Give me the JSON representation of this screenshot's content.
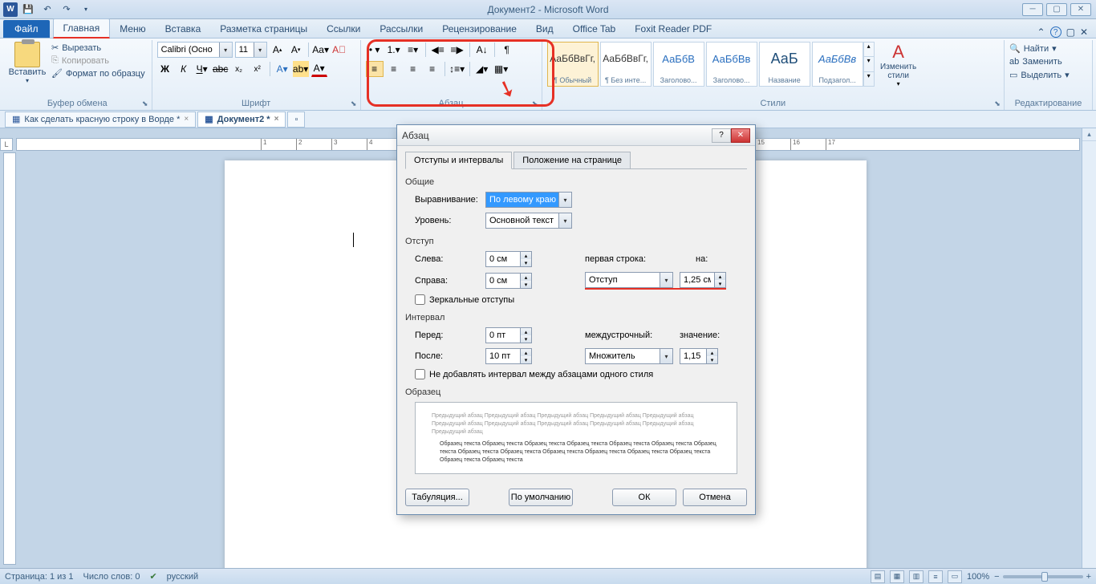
{
  "titlebar": {
    "title": "Документ2 - Microsoft Word"
  },
  "tabs": {
    "file": "Файл",
    "home": "Главная",
    "menu": "Меню",
    "insert": "Вставка",
    "layout": "Разметка страницы",
    "refs": "Ссылки",
    "mail": "Рассылки",
    "review": "Рецензирование",
    "view": "Вид",
    "office": "Office Tab",
    "foxit": "Foxit Reader PDF"
  },
  "ribbon": {
    "clipboard": {
      "paste": "Вставить",
      "cut": "Вырезать",
      "copy": "Копировать",
      "format": "Формат по образцу",
      "label": "Буфер обмена"
    },
    "font": {
      "family": "Calibri (Осно",
      "size": "11",
      "label": "Шрифт"
    },
    "paragraph": {
      "label": "Абзац"
    },
    "styles": {
      "s1": "¶ Обычный",
      "s2": "¶ Без инте...",
      "s3": "Заголово...",
      "s4": "Заголово...",
      "s5": "Название",
      "s6": "Подзагол...",
      "preview": "АаБбВвГг,",
      "preview2": "АаБбВ",
      "preview3": "АаБбВв",
      "preview4": "АаБ",
      "preview5": "АаБбВв",
      "change": "Изменить стили",
      "label": "Стили"
    },
    "editing": {
      "find": "Найти",
      "replace": "Заменить",
      "select": "Выделить",
      "label": "Редактирование"
    }
  },
  "doctabs": {
    "t1": "Как сделать красную строку в Ворде *",
    "t2": "Документ2 *"
  },
  "dialog": {
    "title": "Абзац",
    "tab1": "Отступы и интервалы",
    "tab2": "Положение на странице",
    "section_general": "Общие",
    "align_label": "Выравнивание:",
    "align_value": "По левому краю",
    "level_label": "Уровень:",
    "level_value": "Основной текст",
    "section_indent": "Отступ",
    "left_label": "Слева:",
    "left_value": "0 см",
    "right_label": "Справа:",
    "right_value": "0 см",
    "firstline_label": "первая строка:",
    "firstline_value": "Отступ",
    "by_label": "на:",
    "by_value": "1,25 см",
    "mirror": "Зеркальные отступы",
    "section_spacing": "Интервал",
    "before_label": "Перед:",
    "before_value": "0 пт",
    "after_label": "После:",
    "after_value": "10 пт",
    "line_label": "междустрочный:",
    "line_value": "Множитель",
    "at_label": "значение:",
    "at_value": "1,15",
    "nospace": "Не добавлять интервал между абзацами одного стиля",
    "section_preview": "Образец",
    "preview_grey": "Предыдущий абзац Предыдущий абзац Предыдущий абзац Предыдущий абзац Предыдущий абзац Предыдущий абзац Предыдущий абзац Предыдущий абзац Предыдущий абзац Предыдущий абзац Предыдущий абзац",
    "preview_dark": "Образец текста Образец текста Образец текста Образец текста Образец текста Образец текста Образец текста Образец текста Образец текста Образец текста Образец текста Образец текста Образец текста Образец текста Образец текста",
    "btn_tabs": "Табуляция...",
    "btn_default": "По умолчанию",
    "btn_ok": "ОК",
    "btn_cancel": "Отмена"
  },
  "statusbar": {
    "page": "Страница: 1 из 1",
    "words": "Число слов: 0",
    "lang": "русский",
    "zoom": "100%"
  },
  "ruler_left": "L"
}
